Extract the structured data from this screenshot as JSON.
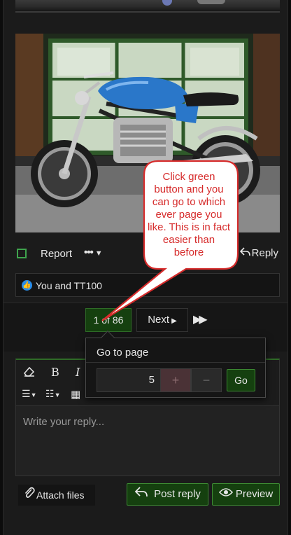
{
  "post": {
    "report_label": "Report",
    "more_label": "•••",
    "reply_label": "Reply"
  },
  "reactions": {
    "text": "You and TT100"
  },
  "pagination": {
    "current": "1 of 86",
    "next_label": "Next"
  },
  "goto_popup": {
    "title": "Go to page",
    "page_value": "5",
    "plus_label": "+",
    "minus_label": "−",
    "go_label": "Go"
  },
  "editor": {
    "placeholder": "Write your reply..."
  },
  "buttons": {
    "attach_label": "Attach files",
    "post_label": "Post reply",
    "preview_label": "Preview"
  },
  "callout": {
    "text": "Click green button and you can go to which ever page you like. This is in fact easier than before"
  },
  "colors": {
    "accent_green": "#15400f",
    "callout_red": "#d62b2b",
    "callout_fill": "#ffffff",
    "like_blue": "#2a8de8"
  }
}
